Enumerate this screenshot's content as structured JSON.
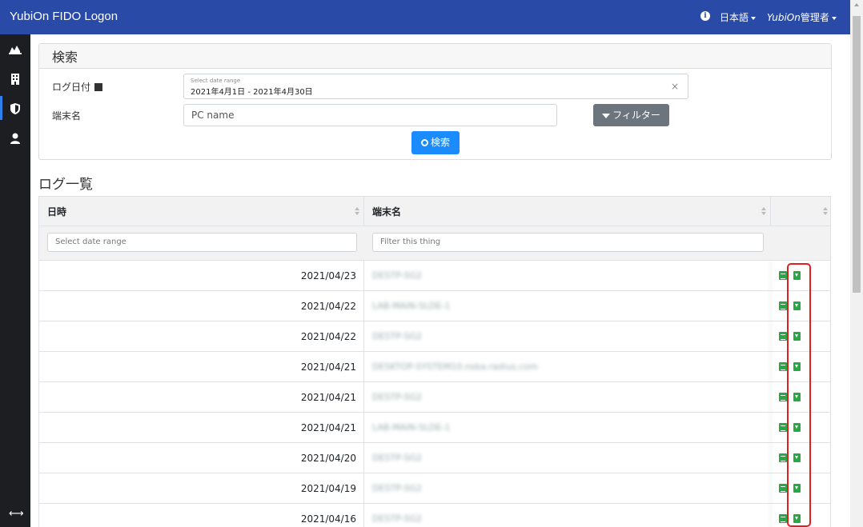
{
  "header": {
    "brand": "YubiOn FIDO Logon",
    "language": "日本語",
    "user_brand": "YubiOn",
    "user_role": "管理者"
  },
  "sidebar": {
    "items": [
      {
        "icon": "chart-icon"
      },
      {
        "icon": "building-icon"
      },
      {
        "icon": "shield-icon",
        "active": true
      },
      {
        "icon": "user-icon"
      }
    ],
    "bottom_icon": "expand-arrows-icon"
  },
  "search": {
    "title": "検索",
    "date_label": "ログ日付",
    "date_small_label": "Select date range",
    "date_value": "2021年4月1日 - 2021年4月30日",
    "clear": "×",
    "pc_label": "端末名",
    "pc_placeholder": "PC name",
    "filter_button": "フィルター",
    "search_button": "検索"
  },
  "log_list": {
    "title": "ログ一覧",
    "columns": [
      "日時",
      "端末名",
      ""
    ],
    "date_filter_placeholder": "Select date range",
    "pc_filter_placeholder": "Filter this thing",
    "rows": [
      {
        "date": "2021/04/23",
        "pc": "DESTP-SG2"
      },
      {
        "date": "2021/04/22",
        "pc": "LAB-MAIN-SLDE-1"
      },
      {
        "date": "2021/04/22",
        "pc": "DESTP-SG2"
      },
      {
        "date": "2021/04/21",
        "pc": "DESKTOP-SYSTEM10.nsba.radius.com"
      },
      {
        "date": "2021/04/21",
        "pc": "DESTP-SG2"
      },
      {
        "date": "2021/04/21",
        "pc": "LAB-MAIN-SLDE-1"
      },
      {
        "date": "2021/04/20",
        "pc": "DESTP-SG2"
      },
      {
        "date": "2021/04/19",
        "pc": "DESTP-SG2"
      },
      {
        "date": "2021/04/16",
        "pc": "DESTP-SG2"
      }
    ]
  },
  "colors": {
    "header_bg": "#2a4aa8",
    "sidebar_bg": "#1c1e22",
    "primary": "#1a8cff",
    "secondary": "#6c757d",
    "success": "#28a745",
    "highlight": "#e02020"
  }
}
